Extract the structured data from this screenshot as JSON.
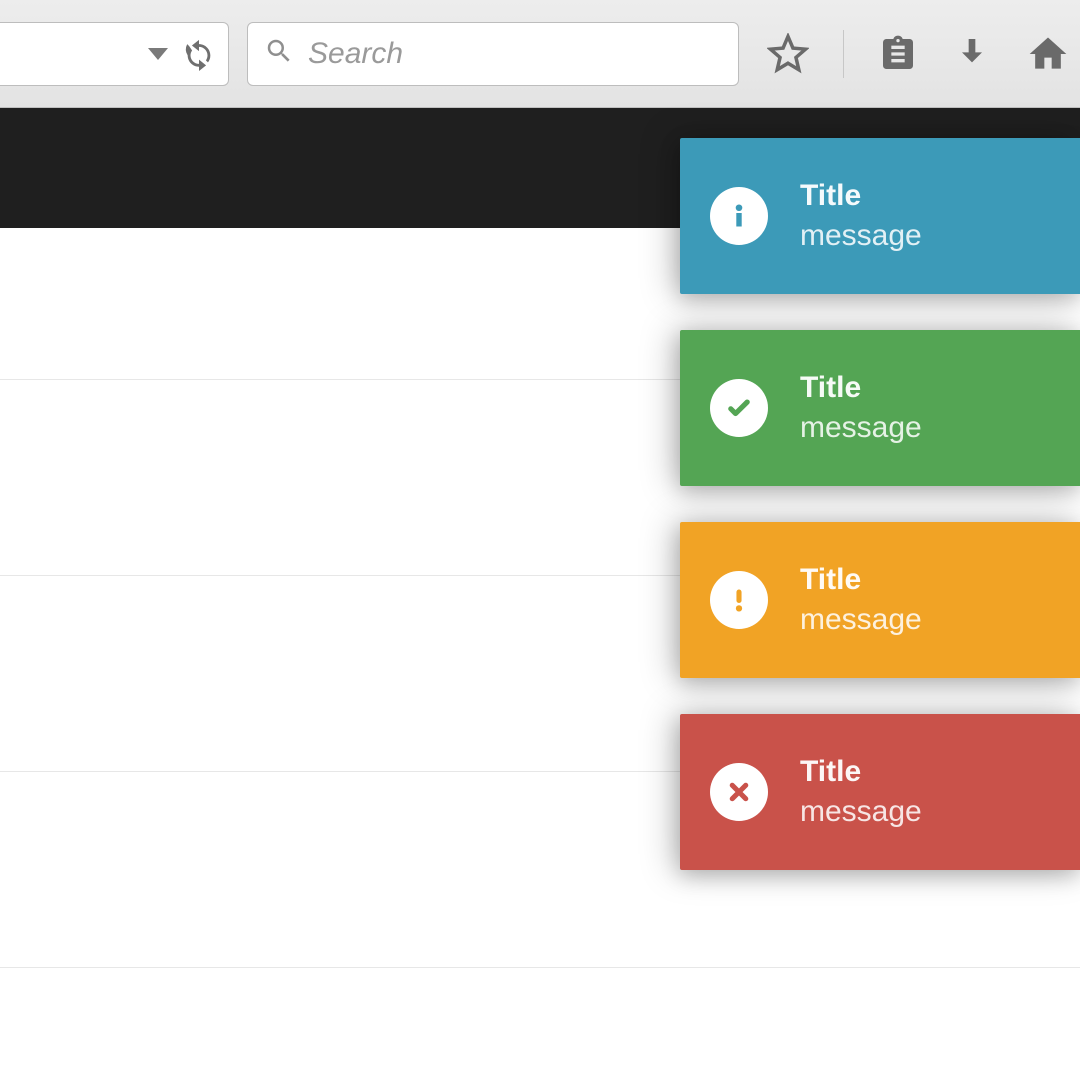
{
  "chrome": {
    "search": {
      "placeholder": "Search"
    }
  },
  "toasts": [
    {
      "type": "info",
      "icon": "info-icon",
      "title": "Title",
      "message": "message",
      "color": "#3c9ab8"
    },
    {
      "type": "success",
      "icon": "check-icon",
      "title": "Title",
      "message": "message",
      "color": "#54a554"
    },
    {
      "type": "warning",
      "icon": "exclamation-icon",
      "title": "Title",
      "message": "message",
      "color": "#f1a325"
    },
    {
      "type": "error",
      "icon": "close-icon",
      "title": "Title",
      "message": "message",
      "color": "#c9524a"
    }
  ]
}
